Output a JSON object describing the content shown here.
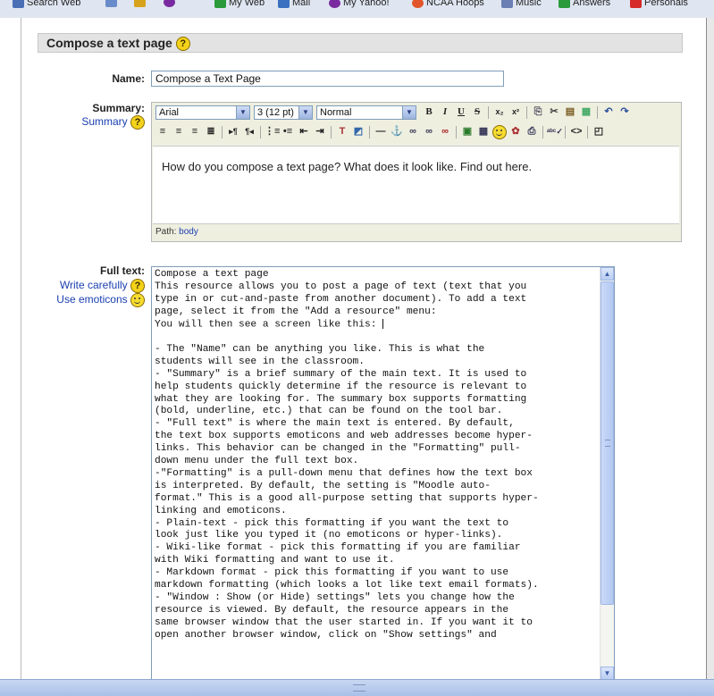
{
  "bookmarks": [
    {
      "label": "Search Web",
      "color": "#4a6fb5"
    },
    {
      "label": "",
      "color": "#6a8bc9"
    },
    {
      "label": "",
      "color": "#d7a21c"
    },
    {
      "label": "",
      "color": "#7a2aa0"
    },
    {
      "label": "My Web",
      "color": "#2a9a3a"
    },
    {
      "label": "Mail",
      "color": "#3b6fc0"
    },
    {
      "label": "My Yahoo!",
      "color": "#7a2aa0"
    },
    {
      "label": "NCAA Hoops",
      "color": "#e2552a"
    },
    {
      "label": "Music",
      "color": "#6b7fb5"
    },
    {
      "label": "Answers",
      "color": "#2a9a3a"
    },
    {
      "label": "Personals",
      "color": "#d62a2a"
    }
  ],
  "header": {
    "title": "Compose a text page",
    "help": "?"
  },
  "name_field": {
    "label": "Name:",
    "value": "Compose a Text Page"
  },
  "summary": {
    "label": "Summary:",
    "link": "Summary",
    "toolbar": {
      "font": "Arial",
      "size": "3 (12 pt)",
      "format": "Normal",
      "bold": "B",
      "italic": "I",
      "underline": "U",
      "strike": "S"
    },
    "text": "How do you compose a text page? What does it look like. Find out here.",
    "path_label": "Path:",
    "path_value": "body"
  },
  "fulltext": {
    "label": "Full text:",
    "link_write": "Write carefully",
    "link_emoticons": "Use emoticons",
    "content": "Compose a text page\nThis resource allows you to post a page of text (text that you\ntype in or cut-and-paste from another document). To add a text\npage, select it from the \"Add a resource\" menu:\nYou will then see a screen like this: \n\n- The \"Name\" can be anything you like. This is what the\nstudents will see in the classroom.\n- \"Summary\" is a brief summary of the main text. It is used to\nhelp students quickly determine if the resource is relevant to\nwhat they are looking for. The summary box supports formatting\n(bold, underline, etc.) that can be found on the tool bar.\n- \"Full text\" is where the main text is entered. By default,\nthe text box supports emoticons and web addresses become hyper-\nlinks. This behavior can be changed in the \"Formatting\" pull-\ndown menu under the full text box.\n-\"Formatting\" is a pull-down menu that defines how the text box\nis interpreted. By default, the setting is \"Moodle auto-\nformat.\" This is a good all-purpose setting that supports hyper-\nlinking and emoticons.\n- Plain-text - pick this formatting if you want the text to\nlook just like you typed it (no emoticons or hyper-links).\n- Wiki-like format - pick this formatting if you are familiar\nwith Wiki formatting and want to use it.\n- Markdown format - pick this formatting if you want to use\nmarkdown formatting (which looks a lot like text email formats).\n- \"Window : Show (or Hide) settings\" lets you change how the\nresource is viewed. By default, the resource appears in the\nsame browser window that the user started in. If you want it to\nopen another browser window, click on \"Show settings\" and"
  }
}
